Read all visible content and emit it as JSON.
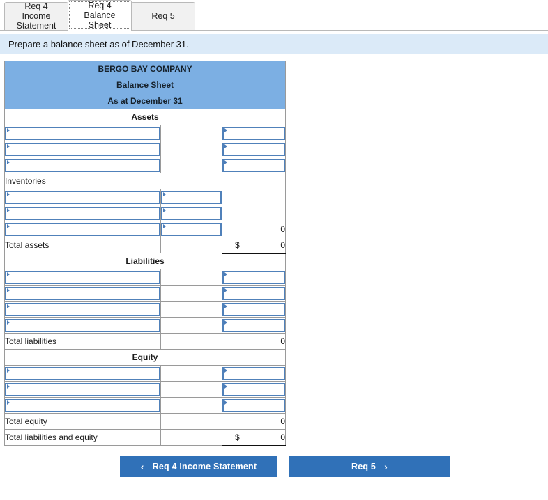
{
  "tabs": [
    {
      "label": "Req 4 Income\nStatement",
      "active": false
    },
    {
      "label": "Req 4 Balance\nSheet",
      "active": true
    },
    {
      "label": "Req 5",
      "active": false
    }
  ],
  "instruction": "Prepare a balance sheet as of December 31.",
  "sheet": {
    "company": "BERGO BAY COMPANY",
    "statement": "Balance Sheet",
    "period": "As at December 31",
    "sections": {
      "assets": "Assets",
      "liabilities": "Liabilities",
      "equity": "Equity"
    },
    "labels": {
      "inventories": "Inventories",
      "total_assets": "Total assets",
      "total_liabilities": "Total liabilities",
      "total_equity": "Total equity",
      "total_liab_equity": "Total liabilities and equity"
    },
    "values": {
      "inventories_subtotal": "0",
      "total_assets": "0",
      "total_liabilities": "0",
      "total_equity": "0",
      "total_liab_equity": "0"
    },
    "currency_symbol": "$",
    "blank_input_value": ""
  },
  "nav": {
    "prev_label": "Req 4 Income Statement",
    "next_label": "Req 5",
    "prev_icon": "chevron-left-icon",
    "next_icon": "chevron-right-icon",
    "prev_chevron": "‹",
    "next_chevron": "›"
  },
  "colors": {
    "header_blue": "#7cafe3",
    "banner_blue": "#dbeaf8",
    "button_blue": "#3071b8",
    "input_border": "#5081ba"
  }
}
